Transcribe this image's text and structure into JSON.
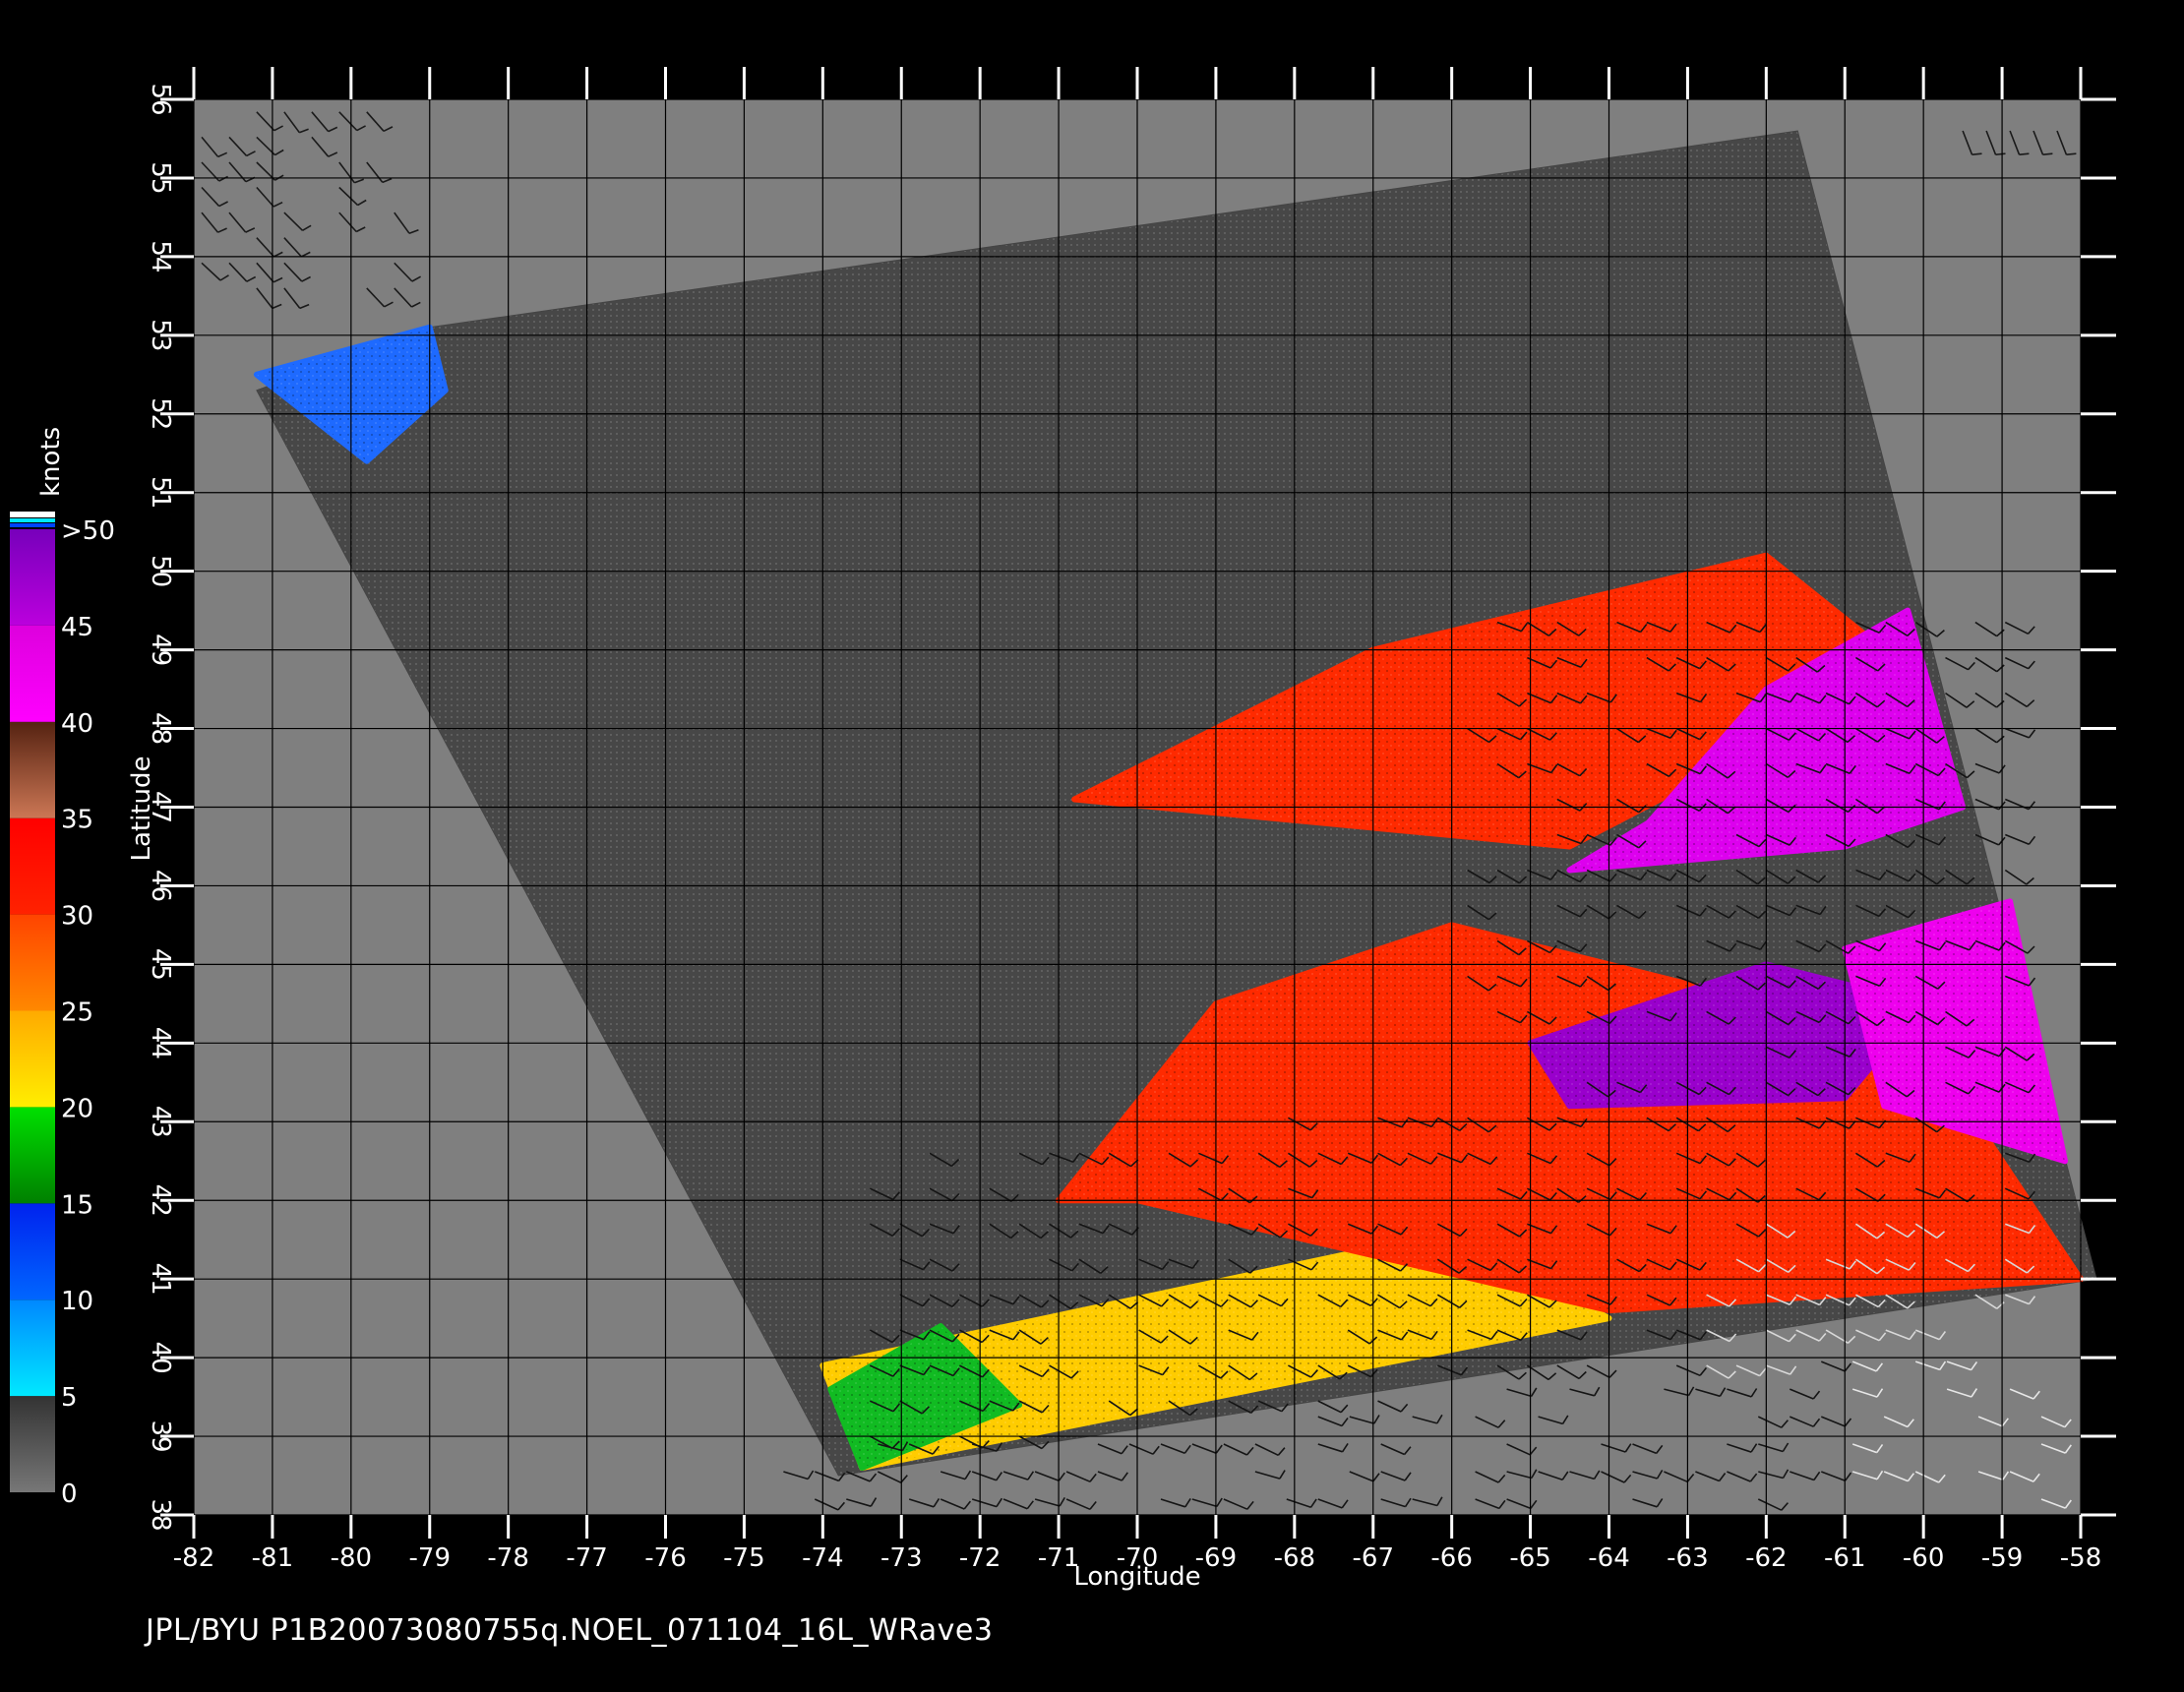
{
  "chart_data": {
    "type": "heatmap",
    "xlabel": "Longitude",
    "ylabel": "Latitude",
    "xlim": [
      -82,
      -58
    ],
    "ylim": [
      38,
      56
    ],
    "x_ticks": [
      "-82",
      "-81",
      "-80",
      "-79",
      "-78",
      "-77",
      "-76",
      "-75",
      "-74",
      "-73",
      "-72",
      "-71",
      "-70",
      "-69",
      "-68",
      "-67",
      "-66",
      "-65",
      "-64",
      "-63",
      "-62",
      "-61",
      "-60",
      "-59",
      "-58"
    ],
    "y_ticks": [
      "38",
      "39",
      "40",
      "41",
      "42",
      "43",
      "44",
      "45",
      "46",
      "47",
      "48",
      "49",
      "50",
      "51",
      "52",
      "53",
      "54",
      "55",
      "56"
    ],
    "grid": true,
    "colorbar": {
      "title": "knots",
      "labels": [
        "0",
        "5",
        "10",
        "15",
        "20",
        "25",
        "30",
        "35",
        "40",
        "45",
        ">50"
      ],
      "bands": [
        {
          "from": 0,
          "to": 5,
          "colors": [
            "#777777",
            "#333333"
          ]
        },
        {
          "from": 5,
          "to": 10,
          "colors": [
            "#00e8ff",
            "#0088ff"
          ]
        },
        {
          "from": 10,
          "to": 15,
          "colors": [
            "#0066ff",
            "#0022ee"
          ]
        },
        {
          "from": 15,
          "to": 20,
          "colors": [
            "#008000",
            "#00e000"
          ]
        },
        {
          "from": 20,
          "to": 25,
          "colors": [
            "#ffee00",
            "#ffaa00"
          ]
        },
        {
          "from": 25,
          "to": 30,
          "colors": [
            "#ff8800",
            "#ff4400"
          ]
        },
        {
          "from": 30,
          "to": 35,
          "colors": [
            "#ff2200",
            "#ff0000"
          ]
        },
        {
          "from": 35,
          "to": 40,
          "colors": [
            "#cc7755",
            "#552211"
          ]
        },
        {
          "from": 40,
          "to": 45,
          "colors": [
            "#ff00ff",
            "#dd00dd"
          ]
        },
        {
          "from": 45,
          "to": 50,
          "colors": [
            "#bb00dd",
            "#7700bb"
          ]
        }
      ]
    },
    "swath_outline_lonlat": [
      [
        -79,
        53.1
      ],
      [
        -61.6,
        55.6
      ],
      [
        -57.8,
        41
      ],
      [
        -73.8,
        38.5
      ],
      [
        -81.2,
        52.3
      ]
    ],
    "wind_regions": [
      {
        "speed_knots": "20-25",
        "color": "#ffcc00",
        "outline_lonlat": [
          [
            -74,
            39.9
          ],
          [
            -66,
            41.6
          ],
          [
            -64,
            40.5
          ],
          [
            -73.5,
            38.6
          ]
        ]
      },
      {
        "speed_knots": "15-20",
        "color": "#11bb22",
        "outline_lonlat": [
          [
            -73.9,
            39.6
          ],
          [
            -72.5,
            40.4
          ],
          [
            -71.5,
            39.4
          ],
          [
            -73.5,
            38.6
          ]
        ]
      },
      {
        "speed_knots": "30-35",
        "color": "#ff2a00",
        "outline_lonlat": [
          [
            -71,
            42
          ],
          [
            -69,
            44.5
          ],
          [
            -66,
            45.5
          ],
          [
            -60,
            44
          ],
          [
            -58,
            41
          ],
          [
            -64,
            40.6
          ],
          [
            -70,
            42
          ]
        ]
      },
      {
        "speed_knots": "45-50",
        "color": "#9900cc",
        "outline_lonlat": [
          [
            -65,
            44
          ],
          [
            -62,
            45
          ],
          [
            -60,
            44.5
          ],
          [
            -61,
            43.3
          ],
          [
            -64.5,
            43.2
          ]
        ]
      },
      {
        "speed_knots": "40-45",
        "color": "#ee00ee",
        "outline_lonlat": [
          [
            -61,
            45.2
          ],
          [
            -58.9,
            45.8
          ],
          [
            -58.2,
            42.5
          ],
          [
            -60.5,
            43.2
          ]
        ]
      },
      {
        "speed_knots": "30-35",
        "color": "#ff2a00",
        "outline_lonlat": [
          [
            -70.8,
            47.1
          ],
          [
            -67,
            49
          ],
          [
            -62,
            50.2
          ],
          [
            -60.5,
            49
          ],
          [
            -62,
            47.8
          ],
          [
            -64.5,
            46.5
          ]
        ]
      },
      {
        "speed_knots": "40-45",
        "color": "#dd00ee",
        "outline_lonlat": [
          [
            -64.5,
            46.2
          ],
          [
            -61,
            46.5
          ],
          [
            -59.5,
            47
          ],
          [
            -60.2,
            49.5
          ],
          [
            -62,
            48.5
          ],
          [
            -63.5,
            46.8
          ]
        ]
      },
      {
        "speed_knots": "5-15",
        "color": "#1e6aff",
        "outline_lonlat": [
          [
            -81.2,
            52.5
          ],
          [
            -79,
            53.1
          ],
          [
            -78.8,
            52.3
          ],
          [
            -79.8,
            51.4
          ]
        ]
      }
    ]
  },
  "footer": {
    "caption": "JPL/BYU  P1B20073080755q.NOEL_071104_16L_WRave3"
  }
}
